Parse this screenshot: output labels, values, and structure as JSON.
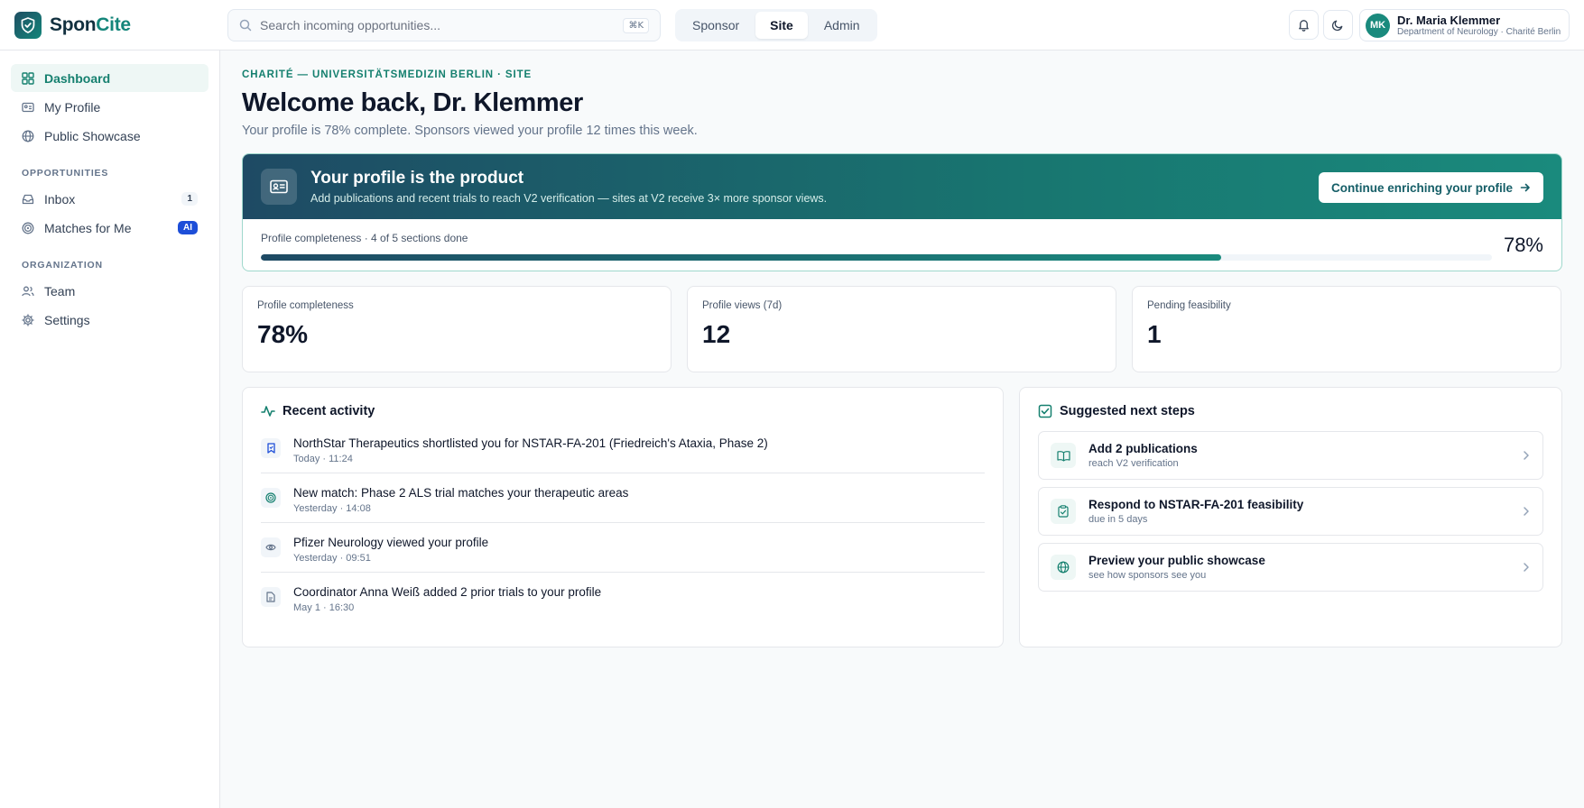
{
  "brand": {
    "name_part1": "Spon",
    "name_part2": "Cite"
  },
  "search": {
    "placeholder": "Search incoming opportunities...",
    "shortcut": "⌘K"
  },
  "roles": {
    "items": [
      "Sponsor",
      "Site",
      "Admin"
    ],
    "active": "Site"
  },
  "user": {
    "initials": "MK",
    "name": "Dr. Maria Klemmer",
    "department": "Department of Neurology · Charité Berlin"
  },
  "sidebar": {
    "main_items": [
      {
        "label": "Dashboard",
        "icon": "grid-icon",
        "active": true
      },
      {
        "label": "My Profile",
        "icon": "id-card-icon"
      },
      {
        "label": "Public Showcase",
        "icon": "globe-icon"
      }
    ],
    "opportunities_heading": "OPPORTUNITIES",
    "opportunities_items": [
      {
        "label": "Inbox",
        "icon": "inbox-icon",
        "badge": "1"
      },
      {
        "label": "Matches for Me",
        "icon": "target-icon",
        "badge": "AI"
      }
    ],
    "organization_heading": "ORGANIZATION",
    "organization_items": [
      {
        "label": "Team",
        "icon": "users-icon"
      },
      {
        "label": "Settings",
        "icon": "gear-icon"
      }
    ]
  },
  "page": {
    "eyebrow": "CHARITÉ — UNIVERSITÄTSMEDIZIN BERLIN · SITE",
    "title": "Welcome back, Dr. Klemmer",
    "subtitle": "Your profile is 78% complete. Sponsors viewed your profile 12 times this week."
  },
  "hero": {
    "title": "Your profile is the product",
    "description": "Add publications and recent trials to reach V2 verification — sites at V2 receive 3× more sponsor views.",
    "cta": "Continue enriching your profile",
    "progress_label": "Profile completeness · 4 of 5 sections done",
    "progress_percent": 78,
    "progress_text": "78%"
  },
  "stats": [
    {
      "label": "Profile completeness",
      "value": "78%"
    },
    {
      "label": "Profile views (7d)",
      "value": "12"
    },
    {
      "label": "Pending feasibility",
      "value": "1"
    }
  ],
  "activity": {
    "heading": "Recent activity",
    "items": [
      {
        "title": "NorthStar Therapeutics shortlisted you for NSTAR-FA-201 (Friedreich's Ataxia, Phase 2)",
        "time": "Today · 11:24",
        "icon": "bookmark-icon"
      },
      {
        "title": "New match: Phase 2 ALS trial matches your therapeutic areas",
        "time": "Yesterday · 14:08",
        "icon": "target-icon"
      },
      {
        "title": "Pfizer Neurology viewed your profile",
        "time": "Yesterday · 09:51",
        "icon": "eye-icon"
      },
      {
        "title": "Coordinator Anna Weiß added 2 prior trials to your profile",
        "time": "May 1 · 16:30",
        "icon": "file-icon"
      }
    ]
  },
  "next_steps": {
    "heading": "Suggested next steps",
    "items": [
      {
        "title": "Add 2 publications",
        "subtitle": "reach V2 verification",
        "icon": "book-icon"
      },
      {
        "title": "Respond to NSTAR-FA-201 feasibility",
        "subtitle": "due in 5 days",
        "icon": "clipboard-check-icon"
      },
      {
        "title": "Preview your public showcase",
        "subtitle": "see how sponsors see you",
        "icon": "globe-icon"
      }
    ]
  },
  "colors": {
    "accent": "#15806f",
    "brand_dark": "#1e4a64",
    "ai_badge": "#1d4ed8"
  }
}
